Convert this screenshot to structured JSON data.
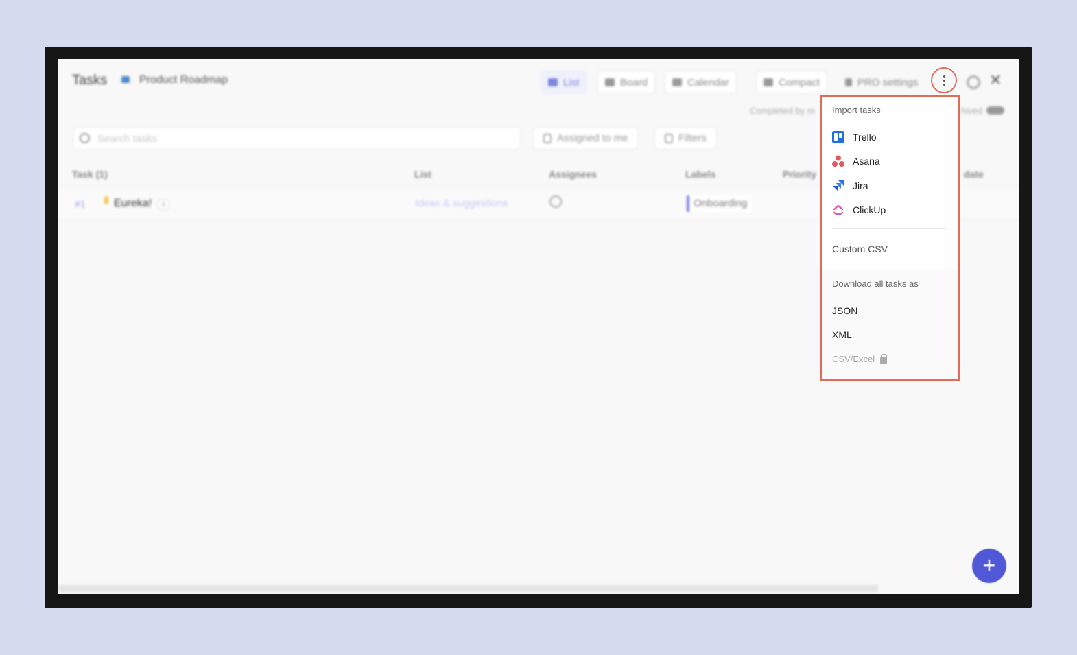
{
  "header": {
    "title": "Tasks",
    "project_name": "Product Roadmap",
    "views": [
      {
        "label": "List",
        "active": true
      },
      {
        "label": "Board",
        "active": false
      },
      {
        "label": "Calendar",
        "active": false
      },
      {
        "label": "Compact",
        "active": false
      }
    ],
    "pro_settings_label": "PRO settings",
    "completed_text": "Completed by m",
    "archived_text": "hived"
  },
  "toolbar": {
    "search_placeholder": "Search tasks",
    "assigned_label": "Assigned to me",
    "filters_label": "Filters"
  },
  "table": {
    "columns": [
      "Task (1)",
      "List",
      "Assignees",
      "Labels",
      "Priority",
      "date"
    ],
    "rows": [
      {
        "number": "#1",
        "task": "Eureka!",
        "badge": "0",
        "list": "Ideas & suggestions",
        "label": "Onboarding"
      }
    ]
  },
  "menu": {
    "import_heading": "Import tasks",
    "import_items": [
      {
        "label": "Trello",
        "icon": "trello-icon"
      },
      {
        "label": "Asana",
        "icon": "asana-icon"
      },
      {
        "label": "Jira",
        "icon": "jira-icon"
      },
      {
        "label": "ClickUp",
        "icon": "clickup-icon"
      }
    ],
    "custom_csv": "Custom CSV",
    "download_heading": "Download all tasks as",
    "download_items": [
      "JSON",
      "XML"
    ],
    "csv_excel": "CSV/Excel"
  },
  "fab_label": "+",
  "colors": {
    "accent": "#5058d8",
    "highlight": "#e26b5b",
    "trello": "#1f6fe0",
    "asana": "#e2595c",
    "jira": "#2b6ff0"
  }
}
